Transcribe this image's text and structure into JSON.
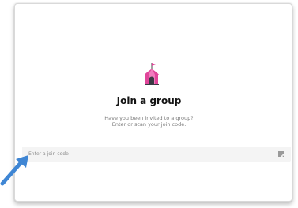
{
  "join_group": {
    "title": "Join a group",
    "subtitle_line1": "Have you been invited to a group?",
    "subtitle_line2": "Enter or scan your join code.",
    "input_placeholder": "Enter a join code",
    "input_value": ""
  },
  "icons": {
    "header_icon": "circus-tent-icon",
    "scan_icon": "qr-code-icon",
    "pointer": "arrow-annotation"
  },
  "colors": {
    "tent_pink": "#e0459a",
    "tent_dark": "#3a3a44",
    "arrow_blue": "#3f86d4",
    "title_text": "#141414",
    "subtitle_text": "#7a7a7a",
    "input_bg": "#f4f4f4"
  }
}
